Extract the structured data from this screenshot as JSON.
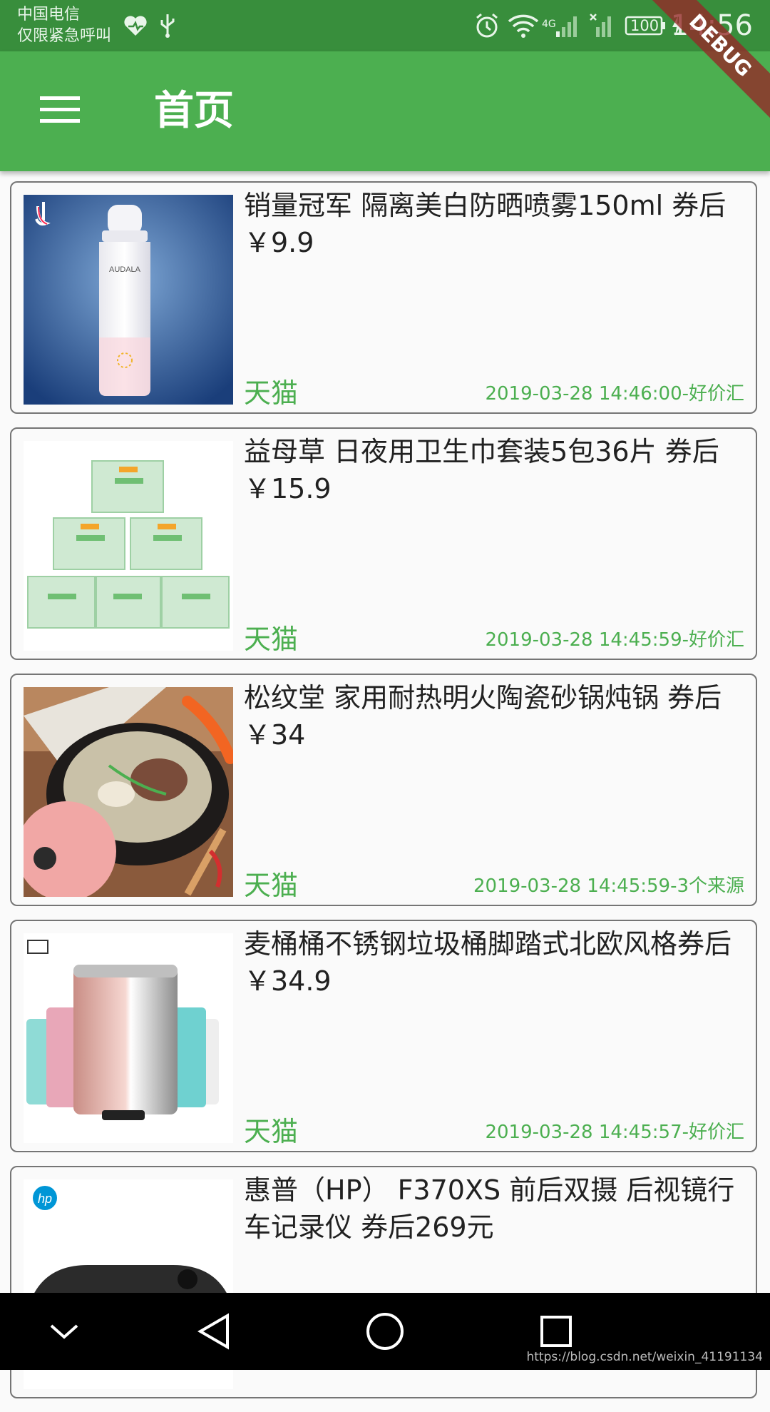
{
  "status_bar": {
    "carrier_line1": "中国电信",
    "carrier_line2": "仅限紧急呼叫",
    "battery": "100",
    "time": "14:56",
    "network": "4G",
    "icons": [
      "heart-icon",
      "usb-icon",
      "alarm-icon",
      "wifi-icon",
      "signal-icon",
      "battery-icon",
      "charging-icon"
    ]
  },
  "debug_banner": "DEBUG",
  "app_bar": {
    "title": "首页",
    "menu_icon": "menu-icon",
    "background": "#4caf50"
  },
  "products": [
    {
      "title": "销量冠军 隔离美白防晒喷雾150ml 券后￥9.9",
      "source": "天猫",
      "meta": "2019-03-28 14:46:00-好价汇",
      "thumb_icon": "spray-bottle-icon"
    },
    {
      "title": "益母草 日夜用卫生巾套装5包36片 券后￥15.9",
      "source": "天猫",
      "meta": "2019-03-28 14:45:59-好价汇",
      "thumb_icon": "pad-boxes-icon"
    },
    {
      "title": "松纹堂 家用耐热明火陶瓷砂锅炖锅 券后￥34",
      "source": "天猫",
      "meta": "2019-03-28 14:45:59-3个来源",
      "thumb_icon": "clay-pot-icon"
    },
    {
      "title": "麦桶桶不锈钢垃圾桶脚踏式北欧风格券后￥34.9",
      "source": "天猫",
      "meta": "2019-03-28 14:45:57-好价汇",
      "thumb_icon": "trash-can-icon"
    },
    {
      "title": "惠普（HP） F370XS 前后双摄 后视镜行车记录仪  券后269元",
      "source": "",
      "meta": "",
      "thumb_icon": "dash-cam-icon"
    }
  ],
  "nav_bar": {
    "buttons": [
      "collapse-icon",
      "back-icon",
      "home-icon",
      "recents-icon"
    ]
  },
  "watermark": "https://blog.csdn.net/weixin_41191134",
  "colors": {
    "accent": "#4caf50",
    "status_bar": "#388e3c",
    "text": "#212121"
  }
}
